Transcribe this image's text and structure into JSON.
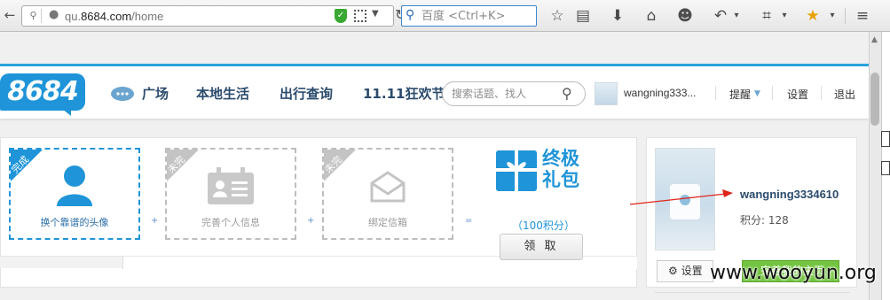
{
  "browser": {
    "url_prefix": "qu.",
    "url_domain": "8684.com",
    "url_path": "/home",
    "search_placeholder": "百度 <Ctrl+K>"
  },
  "header": {
    "logo": "8684",
    "nav": [
      "广场",
      "本地生活",
      "出行查询",
      "11.11狂欢节"
    ],
    "search_placeholder": "搜索话题、找人",
    "username": "wangning333...",
    "remind": "提醒",
    "settings": "设置",
    "logout": "退出"
  },
  "steps": [
    {
      "status": "完成",
      "label": "换个靠谱的头像"
    },
    {
      "status": "未完成",
      "label": "完善个人信息"
    },
    {
      "status": "未完成",
      "label": "绑定信箱"
    }
  ],
  "operators": [
    "+",
    "+",
    "="
  ],
  "gift": {
    "title_line1": "终极",
    "title_line2": "礼包",
    "points": "（100积分）",
    "claim_label": "领 取"
  },
  "profile": {
    "username": "wangning3334610",
    "points": "积分: 128",
    "settings_label": "设置",
    "green_label": "完善我的主页"
  },
  "watermark": "www.wooyun.org",
  "colors": {
    "brand_blue": "#1f94d8",
    "green": "#73c441",
    "arrow": "#e0241b"
  }
}
